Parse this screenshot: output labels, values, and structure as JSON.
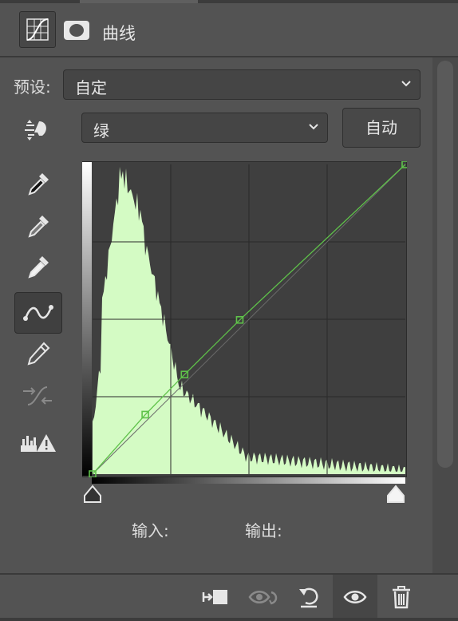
{
  "header": {
    "title": "曲线",
    "icons": [
      "curves-adjustment-icon",
      "layer-mask-icon"
    ]
  },
  "preset": {
    "label": "预设:",
    "value": "自定"
  },
  "channel": {
    "value": "绿"
  },
  "auto_button": {
    "label": "自动"
  },
  "tools": [
    "on-image-adjust-icon",
    "black-point-eyedropper-icon",
    "gray-point-eyedropper-icon",
    "white-point-eyedropper-icon",
    "curve-points-icon",
    "pencil-draw-icon",
    "smooth-curve-icon",
    "clipping-warning-icon"
  ],
  "curve": {
    "channel_color": "#5fc24a",
    "histogram_color": "#d4fbc4",
    "points": [
      [
        0,
        0
      ],
      [
        43,
        49
      ],
      [
        75,
        82
      ],
      [
        120,
        127
      ],
      [
        255,
        255
      ]
    ]
  },
  "io": {
    "input_label": "输入:",
    "output_label": "输出:"
  },
  "footer": {
    "buttons": [
      "clip-to-layer-icon",
      "view-previous-state-icon",
      "reset-icon",
      "visibility-icon",
      "delete-icon"
    ]
  }
}
